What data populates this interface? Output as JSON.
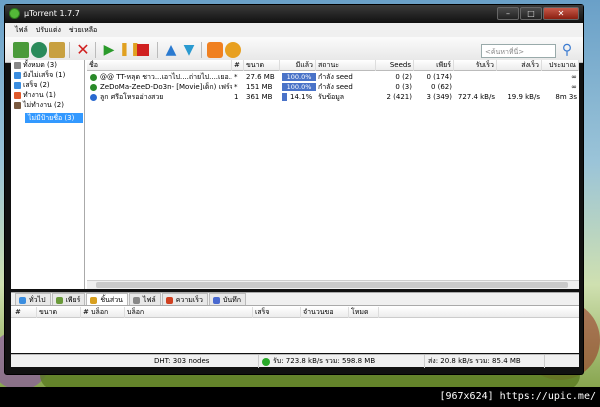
{
  "window": {
    "title": "µTorrent 1.7.7"
  },
  "menu": [
    "ไฟล์",
    "ปรับแต่ง",
    "ช่วยเหลือ"
  ],
  "search": {
    "placeholder": "<ค้นหาที่นี่>"
  },
  "toolbar_icons": [
    "add-torrent-icon",
    "add-url-icon",
    "create-torrent-icon",
    "remove-icon",
    "start-icon",
    "pause-icon",
    "stop-icon",
    "move-up-icon",
    "move-down-icon",
    "rss-icon",
    "preferences-icon",
    "search-engine-icon"
  ],
  "sidebar": {
    "items": [
      {
        "label": "ทั้งหมด (3)",
        "color": "#888888"
      },
      {
        "label": "ยังไม่เสร็จ (1)",
        "color": "#3b8ee0"
      },
      {
        "label": "เสร็จ (2)",
        "color": "#3b8ee0"
      },
      {
        "label": "ทำงาน (1)",
        "color": "#e05a2a"
      },
      {
        "label": "ไม่ทำงาน (2)",
        "color": "#7a5a40"
      }
    ],
    "selected": "ไม่มีป้ายชื่อ (3)"
  },
  "columns": [
    "ชื่อ",
    "#",
    "ขนาด",
    "มีแล้ว",
    "สถานะ",
    "Seeds",
    "เพียร์",
    "รับเร็ว",
    "ส่งเร็ว",
    "ประมาณ"
  ],
  "torrents": [
    {
      "name": "@@ TT-หลุด ชาว...เอาไป....ถ่ายไป....เยอ...",
      "num": "*",
      "size": "27.6 MB",
      "done": "100.0%",
      "progress": 1.0,
      "status": "กำลัง seed",
      "seeds": "0 (2)",
      "peers": "0 (174)",
      "down": "",
      "up": "",
      "eta": "∞",
      "icon_color": "#2a8a2a"
    },
    {
      "name": "ZeDoMa-ZeeD-Do3n- [Movie]เด็ก) เฟร์จ ...",
      "num": "*",
      "size": "151 MB",
      "done": "100.0%",
      "progress": 1.0,
      "status": "กำลัง seed",
      "seeds": "0 (3)",
      "peers": "0 (62)",
      "down": "",
      "up": "",
      "eta": "∞",
      "icon_color": "#2a8a2a"
    },
    {
      "name": "ลูก ศรีอโหรออ่างสวย",
      "num": "1",
      "size": "361 MB",
      "done": "14.1%",
      "progress": 0.141,
      "status": "รับข้อมูล",
      "seeds": "2 (421)",
      "peers": "3 (349)",
      "down": "727.4 kB/s",
      "up": "19.9 kB/s",
      "eta": "8m 3s",
      "icon_color": "#2a6ad0"
    }
  ],
  "tabs": [
    {
      "label": "ทั่วไป",
      "color": "#3b8ee0",
      "active": false
    },
    {
      "label": "เพียร์",
      "color": "#6a9a3a",
      "active": false
    },
    {
      "label": "ชิ้นส่วน",
      "color": "#d8a020",
      "active": true
    },
    {
      "label": "ไฟล์",
      "color": "#888888",
      "active": false
    },
    {
      "label": "ความเร็ว",
      "color": "#d04020",
      "active": false
    },
    {
      "label": "บันทึก",
      "color": "#4a6ad0",
      "active": false
    }
  ],
  "pieces_columns": [
    "#",
    "ขนาด",
    "# บล็อก",
    "บล็อก",
    "เสร็จ",
    "จำนวนขอ",
    "โหมด"
  ],
  "status": {
    "dht": "DHT: 303 nodes",
    "down": "รับ: 723.8 kB/s รวม: 598.8 MB",
    "up": "ส่ง: 20.8 kB/s รวม: 85.4 MB"
  },
  "footer": "[967x624] https://upic.me/"
}
